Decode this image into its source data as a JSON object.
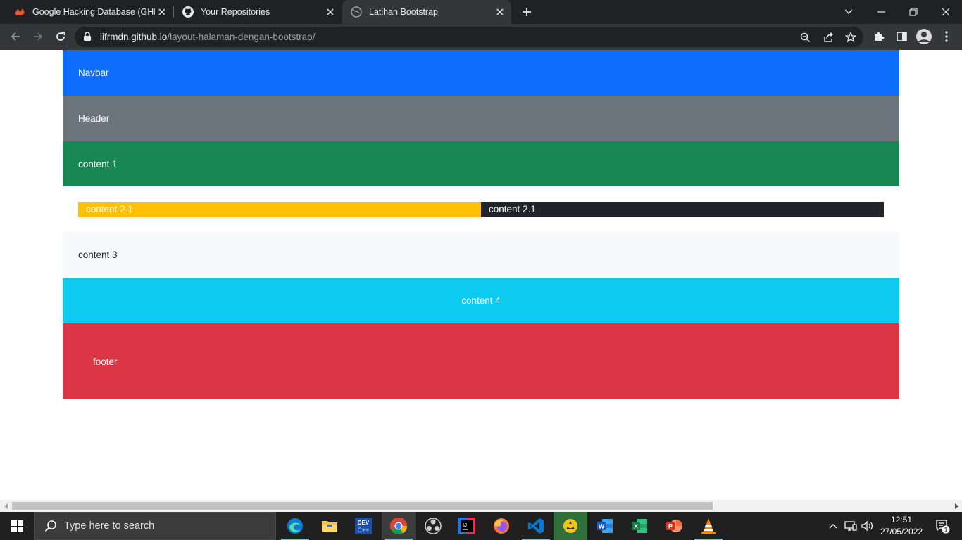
{
  "browser": {
    "tabs": [
      {
        "title": "Google Hacking Database (GHDB)",
        "favicon": "exploit-db-favicon"
      },
      {
        "title": "Your Repositories",
        "favicon": "github-favicon"
      },
      {
        "title": "Latihan Bootstrap",
        "favicon": "globe-favicon",
        "active": true
      }
    ],
    "url_host": "iifrmdn.github.io",
    "url_path": "/layout-halaman-dengan-bootstrap/"
  },
  "page": {
    "navbar": "Navbar",
    "header": "Header",
    "content1": "content 1",
    "content2_left": "content 2.1",
    "content2_right": "content 2.1",
    "content3": "content 3",
    "content4": "content 4",
    "footer": "footer"
  },
  "taskbar": {
    "search_placeholder": "Type here to search",
    "time": "12:51",
    "date": "27/05/2022",
    "notification_count": "1",
    "apps": [
      "edge-icon",
      "file-explorer-icon",
      "dev-cpp-icon",
      "chrome-icon",
      "obs-icon",
      "intellij-icon",
      "firefox-icon",
      "vscode-icon",
      "app-icon",
      "word-icon",
      "excel-icon",
      "powerpoint-icon",
      "vlc-icon"
    ]
  },
  "colors": {
    "primary": "#0d6efd",
    "secondary": "#6c757d",
    "success": "#198754",
    "warning": "#ffc107",
    "dark": "#212529",
    "light": "#f8f9fa",
    "info": "#0dcaf0",
    "danger": "#dc3545"
  }
}
